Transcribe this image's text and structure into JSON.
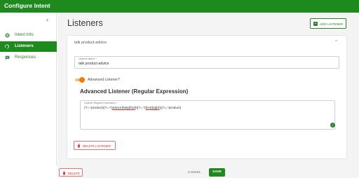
{
  "app": {
    "title": "Configure Intent"
  },
  "sidebar": {
    "collapse_glyph": "‹",
    "items": [
      {
        "label": "Intent Info",
        "icon": "gear-icon",
        "active": false
      },
      {
        "label": "Listeners",
        "icon": "listeners-icon",
        "active": true
      },
      {
        "label": "Responses",
        "icon": "chat-icon",
        "active": false
      }
    ]
  },
  "main": {
    "title": "Listeners",
    "add_button": "ADD LISTENER",
    "panel": {
      "title": "talk product-advice",
      "chevron": "^",
      "listener_name_label": "Listener Name *",
      "listener_name_value": "talk product-advice",
      "advanced_toggle_label": "Advanced Listener?",
      "advanced_on": true,
      "advanced_title": "Advanced Listener (Regular Expression)",
      "regex_label": "Listener Regular Expression *",
      "regex_parts": [
        "(?=.*product)(?=.*(",
        "advice|help|find",
        ")|(?=.*(",
        "best|right",
        "))(?=.*product)"
      ],
      "delete_listener_button": "DELETE LISTENER"
    }
  },
  "footer": {
    "delete_button": "DELETE",
    "cancel_button": "CANCEL",
    "save_button": "SAVE"
  },
  "colors": {
    "brand": "#1e8a1e",
    "danger": "#d32f2f",
    "toggle": "#f57c00"
  }
}
